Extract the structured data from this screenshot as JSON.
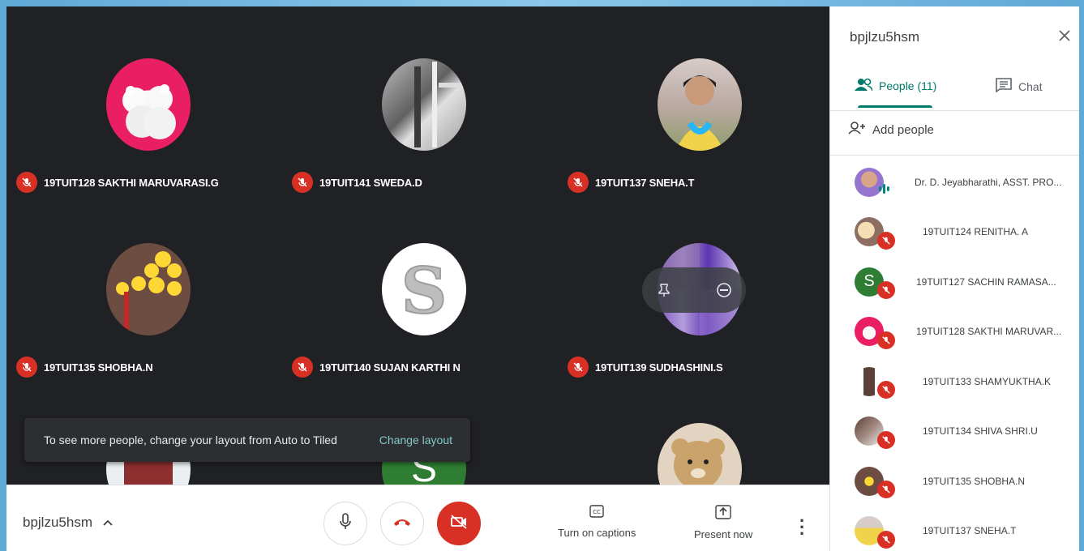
{
  "meeting": {
    "code": "bpjlzu5hsm"
  },
  "tiles": [
    {
      "name": "19TUIT128 SAKTHI MARUVARASI.G"
    },
    {
      "name": "19TUIT141 SWEDA.D"
    },
    {
      "name": "19TUIT137 SNEHA.T"
    },
    {
      "name": "19TUIT135 SHOBHA.N"
    },
    {
      "name": "19TUIT140 SUJAN KARTHI N"
    },
    {
      "name": "19TUIT139 SUDHASHINI.S"
    }
  ],
  "partial_tiles": [
    {
      "letter": "S"
    }
  ],
  "toast": {
    "text": "To see more people, change your layout from Auto to Tiled",
    "action": "Change layout"
  },
  "bottombar": {
    "captions_label": "Turn on captions",
    "present_label": "Present now"
  },
  "panel": {
    "title": "bpjlzu5hsm",
    "tabs": [
      {
        "label": "People (11)"
      },
      {
        "label": "Chat"
      }
    ],
    "add_people": "Add people",
    "people": [
      {
        "name": "Dr. D. Jeyabharathi, ASST. PRO..."
      },
      {
        "name": "19TUIT124 RENITHA. A"
      },
      {
        "name": "19TUIT127 SACHIN RAMASA...",
        "letter": "S"
      },
      {
        "name": "19TUIT128 SAKTHI MARUVAR..."
      },
      {
        "name": "19TUIT133 SHAMYUKTHA.K"
      },
      {
        "name": "19TUIT134 SHIVA SHRI.U"
      },
      {
        "name": "19TUIT135 SHOBHA.N"
      },
      {
        "name": "19TUIT137 SNEHA.T"
      }
    ]
  },
  "colors": {
    "background": "#202124",
    "mic_off": "#d93025",
    "accent": "#00796b"
  }
}
